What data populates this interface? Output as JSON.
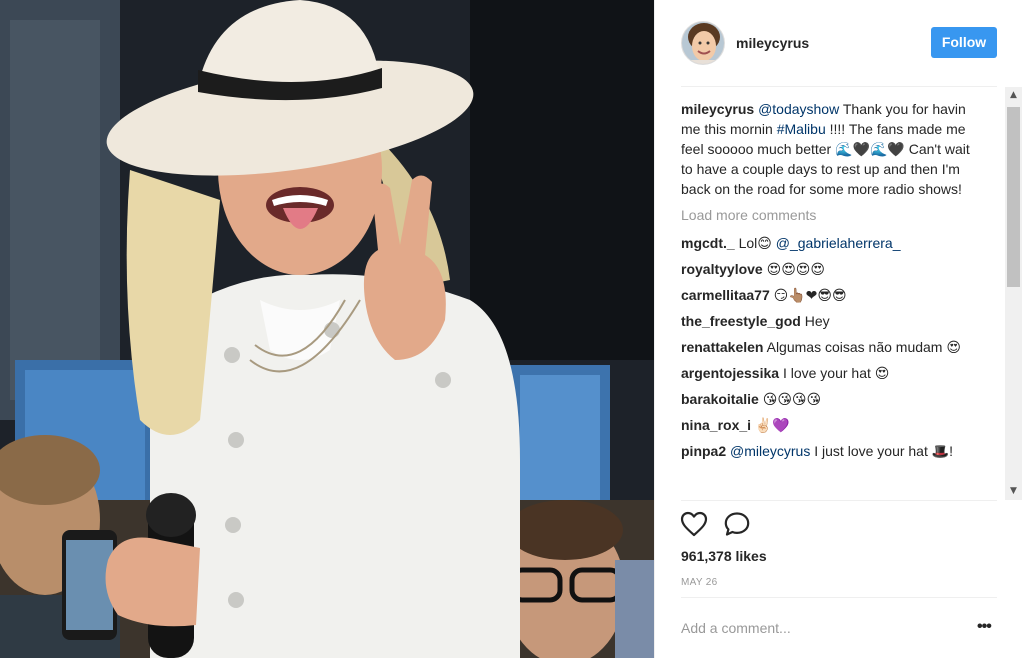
{
  "post": {
    "username": "mileycyrus",
    "follow_label": "Follow",
    "caption": {
      "user": "mileycyrus",
      "mention": "@todayshow",
      "text_1": " Thank you for havin me this mornin ",
      "hashtag": "#Malibu",
      "text_2": " !!!! The fans made me feel sooooo much better 🌊🖤🌊🖤 Can't wait to have a couple days to rest up and then I'm back on the road for some more radio shows!"
    },
    "load_more": "Load more comments",
    "comments": [
      {
        "user": "mgcdt._",
        "text": " Lol😊 ",
        "mention": "@_gabrielaherrera_"
      },
      {
        "user": "royaltyylove",
        "text": " 😍😍😍😍"
      },
      {
        "user": "carmellitaa77",
        "text": " 😏👆🏽❤😎😎"
      },
      {
        "user": "the_freestyle_god",
        "text": " Hey"
      },
      {
        "user": "renattakelen",
        "text": " Algumas coisas não mudam 😍"
      },
      {
        "user": "argentojessika",
        "text": " I love your hat 😍"
      },
      {
        "user": "barakoitalie",
        "text": " 😘😘😘😘"
      },
      {
        "user": "nina_rox_i",
        "text": " ✌🏻💜"
      },
      {
        "user": "pinpa2",
        "mention": "@mileycyrus",
        "text": " I just love your hat 🎩!"
      }
    ],
    "likes": "961,378 likes",
    "date": "MAY 26",
    "add_comment_placeholder": "Add a comment...",
    "more_label": "•••",
    "scroll_up": "▲",
    "scroll_down": "▼"
  },
  "icons": {
    "like": "heart-icon",
    "comment": "speech-bubble-icon",
    "more": "ellipsis-icon"
  },
  "colors": {
    "follow_button": "#3897f0",
    "link": "#003569",
    "muted": "#999999"
  }
}
